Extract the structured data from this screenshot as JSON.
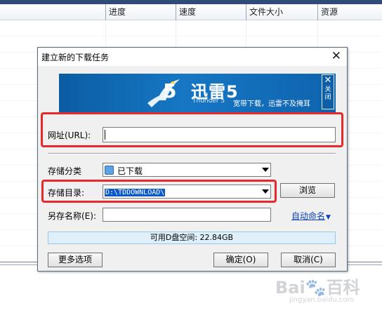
{
  "background_window": {
    "columns": [
      "进度",
      "速度",
      "文件大小",
      "资源"
    ]
  },
  "dialog": {
    "title": "建立新的下载任务",
    "close_glyph": "✕",
    "banner": {
      "app_name": "迅雷5",
      "english_name": "Thunder 5",
      "slogan": "宽带下载，迅雷不及掩耳",
      "close_glyph": "✕",
      "close_label": "关闭"
    },
    "url": {
      "label": "网址(URL):",
      "value": ""
    },
    "category": {
      "label": "存储分类",
      "selected": "已下载"
    },
    "directory": {
      "label": "存储目录:",
      "selected": "D:\\TDDOWNLOAD\\"
    },
    "browse_button": "浏览",
    "save_as": {
      "label": "另存名称(E):",
      "value": ""
    },
    "auto_rename": {
      "label": "自动命名",
      "glyph": "▼"
    },
    "free_space": "可用D盘空间: 22.84GB",
    "more_options_button": "更多选项",
    "ok_button": "确定(O)",
    "cancel_button": "取消(C)"
  },
  "watermark": {
    "text": "Bai🐾百科",
    "sub": "jingyan.baidu.com"
  },
  "colors": {
    "highlight": "#e8282c",
    "banner": "#1677c4",
    "link": "#0b3fb8",
    "selection": "#0a58c9"
  }
}
